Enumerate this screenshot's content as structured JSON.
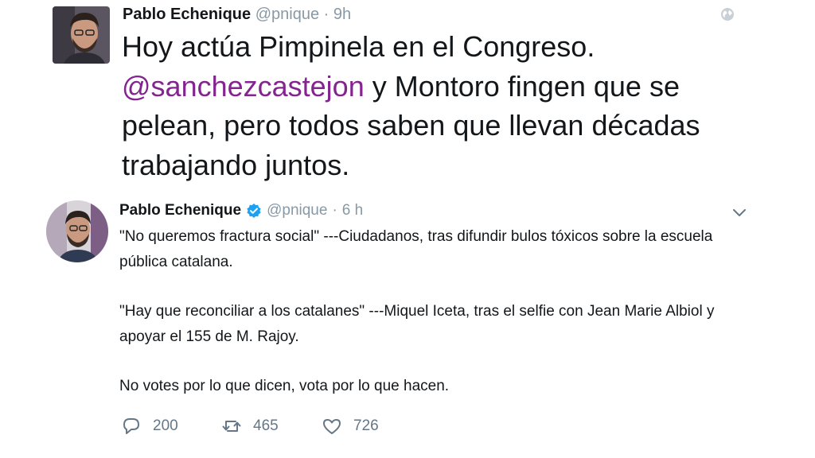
{
  "tweet1": {
    "author_name": "Pablo Echenique",
    "handle": "@pnique",
    "separator": "·",
    "time": "9h",
    "text_line1": "Hoy actúa Pimpinela en el Congreso.",
    "mention": "@sanchezcastejon",
    "text_after_mention": " y Montoro fingen que se pelean, pero todos saben que llevan décadas trabajando juntos."
  },
  "tweet2": {
    "author_name": "Pablo Echenique",
    "handle": "@pnique",
    "separator": "·",
    "time": "6 h",
    "paragraphs": [
      "\"No queremos fractura social\" ---Ciudadanos, tras difundir bulos tóxicos sobre la escuela pública catalana.",
      "\"Hay que reconciliar a los catalanes\" ---Miquel Iceta, tras el selfie con Jean Marie Albiol y apoyar el 155 de M. Rajoy.",
      "No votes por lo que dicen, vota por lo que hacen."
    ],
    "actions": {
      "replies": "200",
      "retweets": "465",
      "likes": "726"
    }
  },
  "icons": {
    "globe": "globe-icon",
    "verified": "verified-badge-icon",
    "chevron": "chevron-down-icon",
    "reply": "reply-icon",
    "retweet": "retweet-icon",
    "like": "heart-icon"
  },
  "colors": {
    "mention": "#84248f",
    "verified": "#1da1f2",
    "meta_text": "#8899a6",
    "action_icon": "#657786"
  }
}
